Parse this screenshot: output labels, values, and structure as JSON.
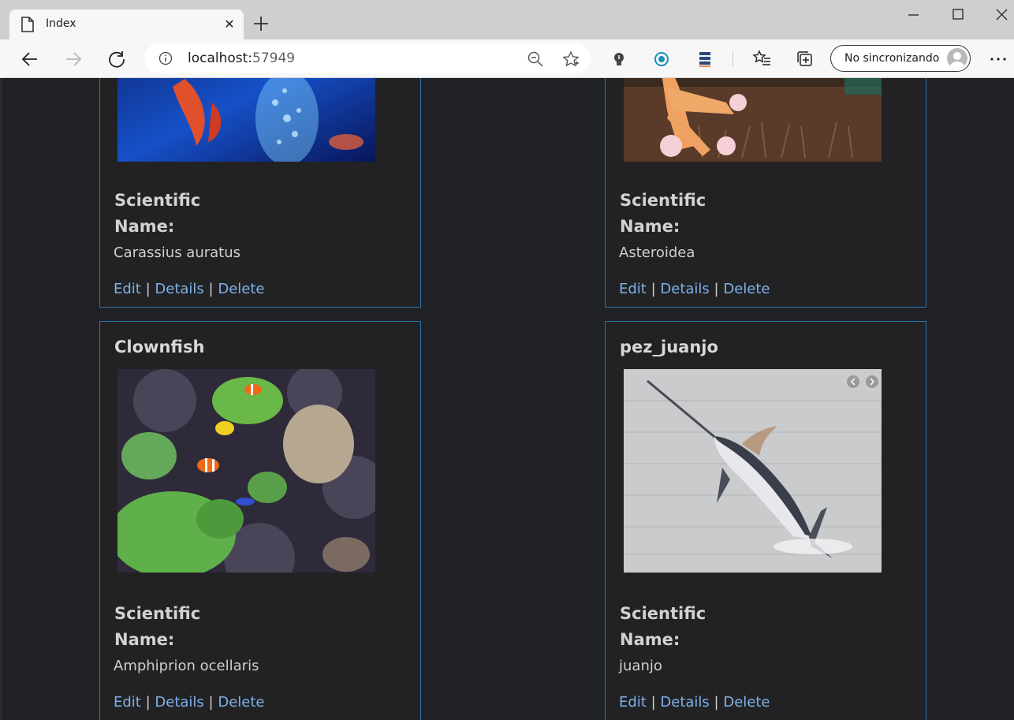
{
  "browser": {
    "tab_title": "Index",
    "address_host": "localhost:",
    "address_port": "57949",
    "sync_label": "No sincronizando"
  },
  "cards": [
    {
      "name": "",
      "label_line1": "Scientific",
      "label_line2": "Name:",
      "scientific_name": "Carassius auratus",
      "image": "goldfish-aquarium-photo"
    },
    {
      "name": "",
      "label_line1": "Scientific",
      "label_line2": "Name:",
      "scientific_name": "Asteroidea",
      "image": "starfish-coral-photo"
    },
    {
      "name": "Clownfish",
      "label_line1": "Scientific",
      "label_line2": "Name:",
      "scientific_name": "Amphiprion ocellaris",
      "image": "clownfish-reef-photo"
    },
    {
      "name": "pez_juanjo",
      "label_line1": "Scientific",
      "label_line2": "Name:",
      "scientific_name": "juanjo",
      "image": "marlin-jumping-photo"
    }
  ],
  "actions": {
    "edit": "Edit",
    "details": "Details",
    "delete": "Delete",
    "separator": "|"
  },
  "colors": {
    "page_bg": "#202124",
    "card_border": "#2a74b0",
    "link": "#7fb1e8"
  }
}
